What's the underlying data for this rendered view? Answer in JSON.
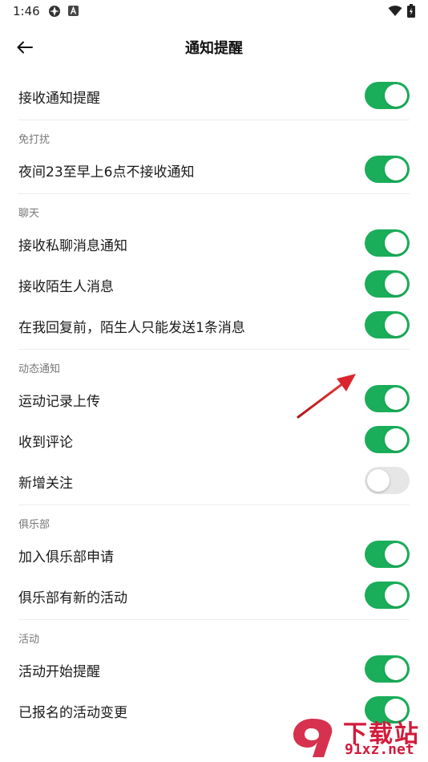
{
  "status_bar": {
    "time": "1:46",
    "icons": [
      "app-icon",
      "a-badge-icon",
      "wifi-icon",
      "battery-icon"
    ]
  },
  "header": {
    "title": "通知提醒",
    "back_icon": "arrow-left-icon"
  },
  "sections": [
    {
      "header": "",
      "items": [
        {
          "label": "接收通知提醒",
          "on": true
        }
      ]
    },
    {
      "header": "免打扰",
      "items": [
        {
          "label": "夜间23至早上6点不接收通知",
          "on": true
        }
      ]
    },
    {
      "header": "聊天",
      "items": [
        {
          "label": "接收私聊消息通知",
          "on": true
        },
        {
          "label": "接收陌生人消息",
          "on": true
        },
        {
          "label": "在我回复前，陌生人只能发送1条消息",
          "on": true
        }
      ]
    },
    {
      "header": "动态通知",
      "items": [
        {
          "label": "运动记录上传",
          "on": true
        },
        {
          "label": "收到评论",
          "on": true
        },
        {
          "label": "新增关注",
          "on": false
        }
      ]
    },
    {
      "header": "俱乐部",
      "items": [
        {
          "label": "加入俱乐部申请",
          "on": true
        },
        {
          "label": "俱乐部有新的活动",
          "on": true
        }
      ]
    },
    {
      "header": "活动",
      "items": [
        {
          "label": "活动开始提醒",
          "on": true
        },
        {
          "label": "已报名的活动变更",
          "on": true
        }
      ]
    }
  ],
  "colors": {
    "toggle_on": "#1aad5a",
    "toggle_off": "#e6e6e6",
    "annotation_arrow": "#d9262c",
    "watermark": "#d21b3b"
  },
  "watermark": {
    "brand": "下载站",
    "domain": "91xz.net"
  }
}
